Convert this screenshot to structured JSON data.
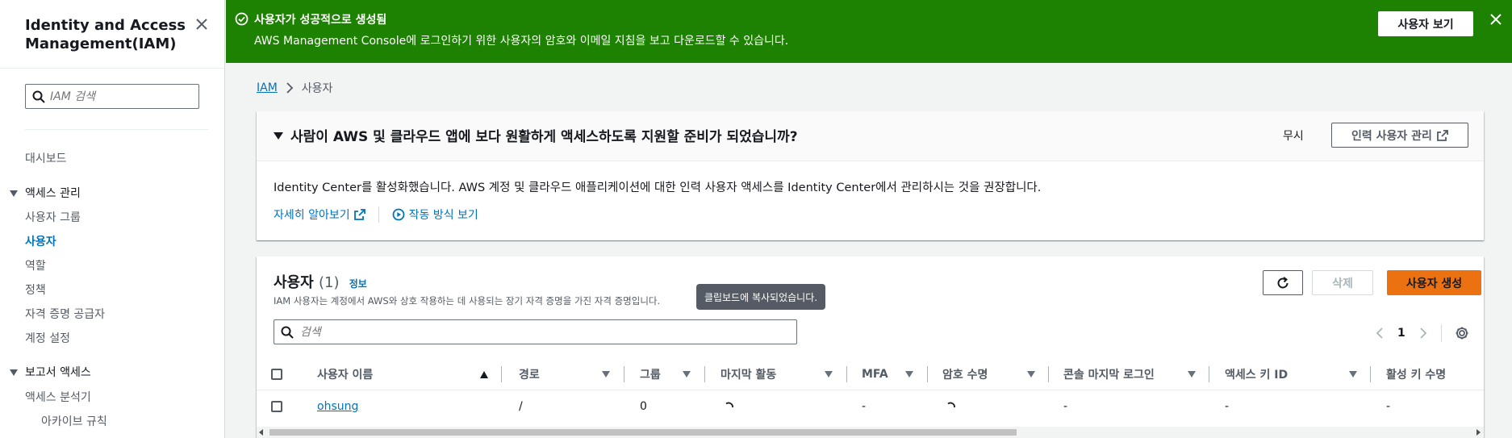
{
  "sidebar": {
    "title": "Identity and Access Management(IAM)",
    "search_placeholder": "IAM 검색",
    "dashboard": "대시보드",
    "section_access": "액세스 관리",
    "access_items": [
      "사용자 그룹",
      "사용자",
      "역할",
      "정책",
      "자격 증명 공급자",
      "계정 설정"
    ],
    "active_item": "사용자",
    "section_reports": "보고서 액세스",
    "report_items": [
      "액세스 분석기"
    ],
    "sub_items": [
      "아카이브 규칙"
    ]
  },
  "flash": {
    "title": "사용자가 성공적으로 생성됨",
    "message": "AWS Management Console에 로그인하기 위한 사용자의 암호와 이메일 지침을 보고 다운로드할 수 있습니다.",
    "button": "사용자 보기",
    "color": "#1d8102"
  },
  "breadcrumb": {
    "root": "IAM",
    "current": "사용자"
  },
  "identity_center": {
    "title": "사람이 AWS 및 클라우드 앱에 보다 원활하게 액세스하도록 지원할 준비가 되었습니까?",
    "dismiss": "무시",
    "manage_button": "인력 사용자 관리",
    "body": "Identity Center를 활성화했습니다. AWS 계정 및 클라우드 애플리케이션에 대한 인력 사용자 액세스를 Identity Center에서 관리하시는 것을 권장합니다.",
    "learn_more": "자세히 알아보기",
    "how_it_works": "작동 방식 보기"
  },
  "users": {
    "title": "사용자",
    "count": "(1)",
    "info": "정보",
    "description": "IAM 사용자는 계정에서 AWS와 상호 작용하는 데 사용되는 장기 자격 증명을 가진 자격 증명입니다.",
    "tooltip": "클립보드에 복사되었습니다.",
    "delete_button": "삭제",
    "create_button": "사용자 생성",
    "search_placeholder": "검색",
    "page": "1",
    "columns": [
      "사용자 이름",
      "경로",
      "그룹",
      "마지막 활동",
      "MFA",
      "암호 수명",
      "콘솔 마지막 로그인",
      "액세스 키 ID",
      "활성 키 수명"
    ],
    "rows": [
      {
        "user_name": "ohsung",
        "path": "/",
        "groups": "0",
        "mfa": "-",
        "console_last_login": "-",
        "access_key_id": "-",
        "active_key_age": "-"
      }
    ],
    "accent_color": "#ec7211"
  }
}
